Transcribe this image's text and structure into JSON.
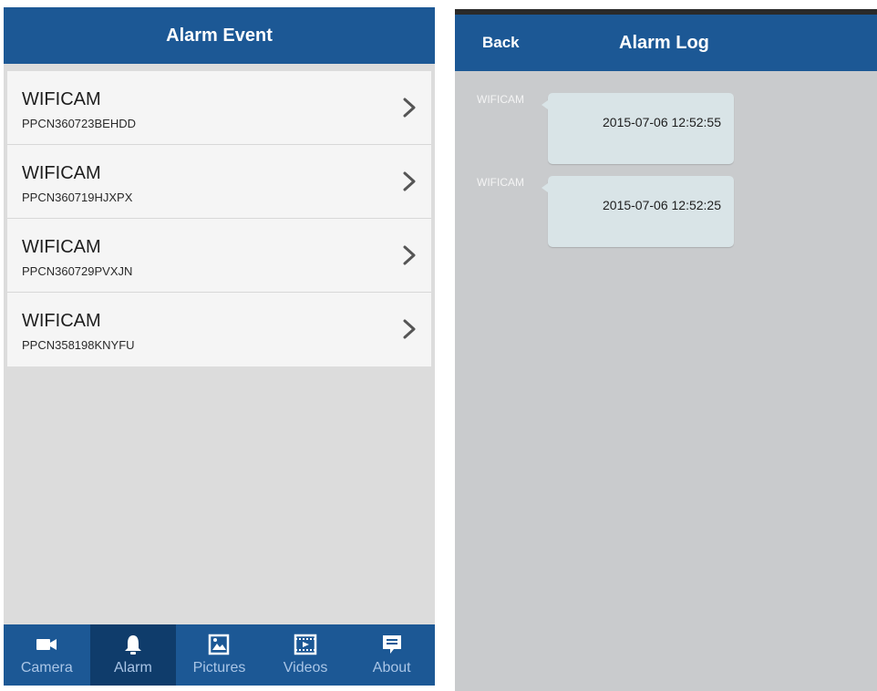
{
  "alarm_event": {
    "title": "Alarm Event",
    "devices": [
      {
        "name": "WIFICAM",
        "id": "PPCN360723BEHDD"
      },
      {
        "name": "WIFICAM",
        "id": "PPCN360719HJXPX"
      },
      {
        "name": "WIFICAM",
        "id": "PPCN360729PVXJN"
      },
      {
        "name": "WIFICAM",
        "id": "PPCN358198KNYFU"
      }
    ],
    "tabs": [
      {
        "label": "Camera",
        "icon": "camera-icon",
        "active": false
      },
      {
        "label": "Alarm",
        "icon": "bell-icon",
        "active": true
      },
      {
        "label": "Pictures",
        "icon": "picture-icon",
        "active": false
      },
      {
        "label": "Videos",
        "icon": "film-icon",
        "active": false
      },
      {
        "label": "About",
        "icon": "message-icon",
        "active": false
      }
    ]
  },
  "alarm_log": {
    "back_label": "Back",
    "title": "Alarm Log",
    "entries": [
      {
        "sender": "WIFICAM",
        "time": "2015-07-06 12:52:55"
      },
      {
        "sender": "WIFICAM",
        "time": "2015-07-06 12:52:25"
      }
    ]
  },
  "colors": {
    "header_blue": "#1c5895",
    "active_tab": "#0f3c6b",
    "tab_text": "#a9c5e6",
    "left_background": "#dcdcdc",
    "right_background": "#c9cbcd",
    "bubble": "#d9e4e7"
  }
}
